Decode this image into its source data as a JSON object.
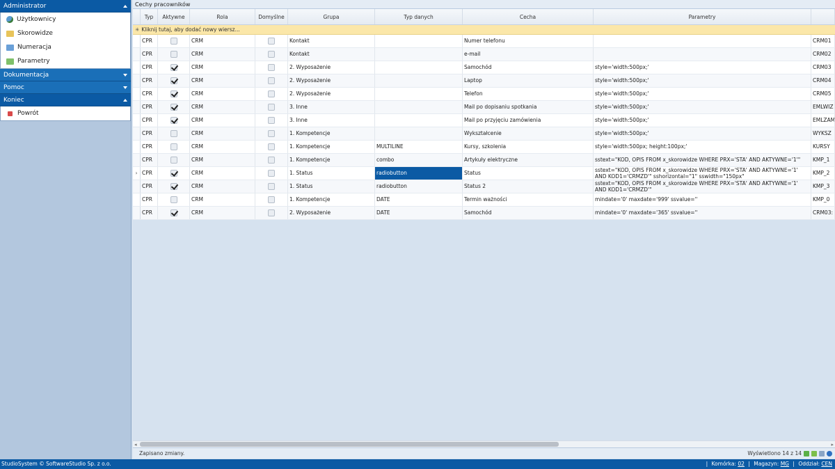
{
  "sidebar": {
    "sections": [
      {
        "label": "Administrator",
        "expanded": true,
        "items": [
          {
            "label": "Użytkownicy",
            "icon": "users-icon"
          },
          {
            "label": "Skorowidze",
            "icon": "folder-icon"
          },
          {
            "label": "Numeracja",
            "icon": "folder-icon"
          },
          {
            "label": "Parametry",
            "icon": "folder-icon"
          }
        ]
      },
      {
        "label": "Dokumentacja",
        "expanded": false
      },
      {
        "label": "Pomoc",
        "expanded": false
      },
      {
        "label": "Koniec",
        "expanded": true,
        "items": [
          {
            "label": "Powrót",
            "icon": "stop-icon"
          }
        ]
      }
    ]
  },
  "panel": {
    "title": "Cechy pracowników",
    "columns": [
      "Typ",
      "Aktywne",
      "Rola",
      "Domyślne",
      "Grupa",
      "Typ danych",
      "Cecha",
      "Parametry",
      ""
    ],
    "new_row_text": "Kliknij tutaj, aby dodać nowy wiersz...",
    "rows": [
      {
        "typ": "CPR",
        "aktywne": false,
        "rola": "CRM",
        "domyslne": false,
        "grupa": "Kontakt",
        "typ_danych": "",
        "cecha": "Numer telefonu",
        "parametry": "",
        "kod": "CRM01"
      },
      {
        "typ": "CPR",
        "aktywne": false,
        "rola": "CRM",
        "domyslne": false,
        "grupa": "Kontakt",
        "typ_danych": "",
        "cecha": "e-mail",
        "parametry": "",
        "kod": "CRM02"
      },
      {
        "typ": "CPR",
        "aktywne": true,
        "rola": "CRM",
        "domyslne": false,
        "grupa": "2. Wyposażenie",
        "typ_danych": "",
        "cecha": "Samochód",
        "parametry": "style='width:500px;'",
        "kod": "CRM03"
      },
      {
        "typ": "CPR",
        "aktywne": true,
        "rola": "CRM",
        "domyslne": false,
        "grupa": "2. Wyposażenie",
        "typ_danych": "",
        "cecha": "Laptop",
        "parametry": "style='width:500px;'",
        "kod": "CRM04"
      },
      {
        "typ": "CPR",
        "aktywne": true,
        "rola": "CRM",
        "domyslne": false,
        "grupa": "2. Wyposażenie",
        "typ_danych": "",
        "cecha": "Telefon",
        "parametry": "style='width:500px;'",
        "kod": "CRM05"
      },
      {
        "typ": "CPR",
        "aktywne": true,
        "rola": "CRM",
        "domyslne": false,
        "grupa": "3. Inne",
        "typ_danych": "",
        "cecha": "Mail po dopisaniu spotkania",
        "parametry": "style='width:500px;'",
        "kod": "EMLWIZ"
      },
      {
        "typ": "CPR",
        "aktywne": true,
        "rola": "CRM",
        "domyslne": false,
        "grupa": "3. Inne",
        "typ_danych": "",
        "cecha": "Mail po przyjęciu zamówienia",
        "parametry": "style='width:500px;'",
        "kod": "EMLZAM"
      },
      {
        "typ": "CPR",
        "aktywne": false,
        "rola": "CRM",
        "domyslne": false,
        "grupa": "1. Kompetencje",
        "typ_danych": "",
        "cecha": "Wykształcenie",
        "parametry": "style='width:500px;'",
        "kod": "WYKSZ"
      },
      {
        "typ": "CPR",
        "aktywne": false,
        "rola": "CRM",
        "domyslne": false,
        "grupa": "1. Kompetencje",
        "typ_danych": "MULTILINE",
        "cecha": "Kursy, szkolenia",
        "parametry": "style='width:500px; height:100px;'",
        "kod": "KURSY"
      },
      {
        "typ": "CPR",
        "aktywne": false,
        "rola": "CRM",
        "domyslne": false,
        "grupa": "1. Kompetencje",
        "typ_danych": "combo",
        "cecha": "Artykuły elektryczne",
        "parametry": "sstext=\"KOD, OPIS FROM x_skorowidze WHERE PRX='STA' AND AKTYWNE='1'\"",
        "kod": "KMP_1"
      },
      {
        "typ": "CPR",
        "aktywne": true,
        "rola": "CRM",
        "domyslne": false,
        "grupa": "1. Status",
        "typ_danych": "radiobutton",
        "cecha": "Status",
        "parametry": "sstext=\"KOD, OPIS FROM x_skorowidze WHERE PRX='STA' AND AKTYWNE='1' AND KOD1='CRMZD'\" sshorizontal=\"1\" sswidth=\"150px\"",
        "kod": "KMP_2",
        "current": true,
        "selected_col": "typ_danych"
      },
      {
        "typ": "CPR",
        "aktywne": true,
        "rola": "CRM",
        "domyslne": false,
        "grupa": "1. Status",
        "typ_danych": "radiobutton",
        "cecha": "Status 2",
        "parametry": "sstext=\"KOD, OPIS FROM x_skorowidze WHERE PRX='STA' AND AKTYWNE='1' AND KOD1='CRMZD'\"",
        "kod": "KMP_3"
      },
      {
        "typ": "CPR",
        "aktywne": false,
        "rola": "CRM",
        "domyslne": false,
        "grupa": "1. Kompetencje",
        "typ_danych": "DATE",
        "cecha": "Termin ważności",
        "parametry": "mindate='0' maxdate='999' ssvalue=''",
        "kod": "KMP_0"
      },
      {
        "typ": "CPR",
        "aktywne": true,
        "rola": "CRM",
        "domyslne": false,
        "grupa": "2. Wyposażenie",
        "typ_danych": "DATE",
        "cecha": "Samochód",
        "parametry": "mindate='0' maxdate='365' ssvalue=''",
        "kod": "CRM03:"
      }
    ]
  },
  "status": {
    "message": "Zapisano zmiany.",
    "count": "Wyświetlono 14 z 14"
  },
  "footer": {
    "copyright": "StudioSystem © SoftwareStudio Sp. z o.o.",
    "komorka_label": "Komórka:",
    "komorka_value": "02",
    "magazyn_label": "Magazyn:",
    "magazyn_value": "MG",
    "oddzial_label": "Oddział:",
    "oddzial_value": "CEN"
  }
}
